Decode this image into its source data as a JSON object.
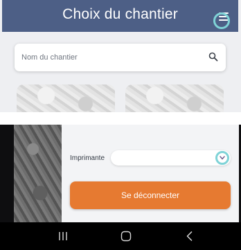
{
  "header": {
    "title": "Choix du chantier",
    "menu_icon": "hamburger-menu-icon"
  },
  "search": {
    "placeholder": "Nom du chantier",
    "value": "",
    "icon": "search-icon"
  },
  "settings": {
    "printer_label": "Imprimante",
    "printer_value": "",
    "logout_label": "Se déconnecter"
  },
  "navbar": {
    "recent_icon": "recent-apps-icon",
    "home_icon": "home-icon",
    "back_icon": "back-icon"
  },
  "colors": {
    "header_bg": "#4d5f86",
    "accent": "#e67a31",
    "touch_indicator": "#7fd3d7",
    "page_bg": "#eeeff2"
  }
}
